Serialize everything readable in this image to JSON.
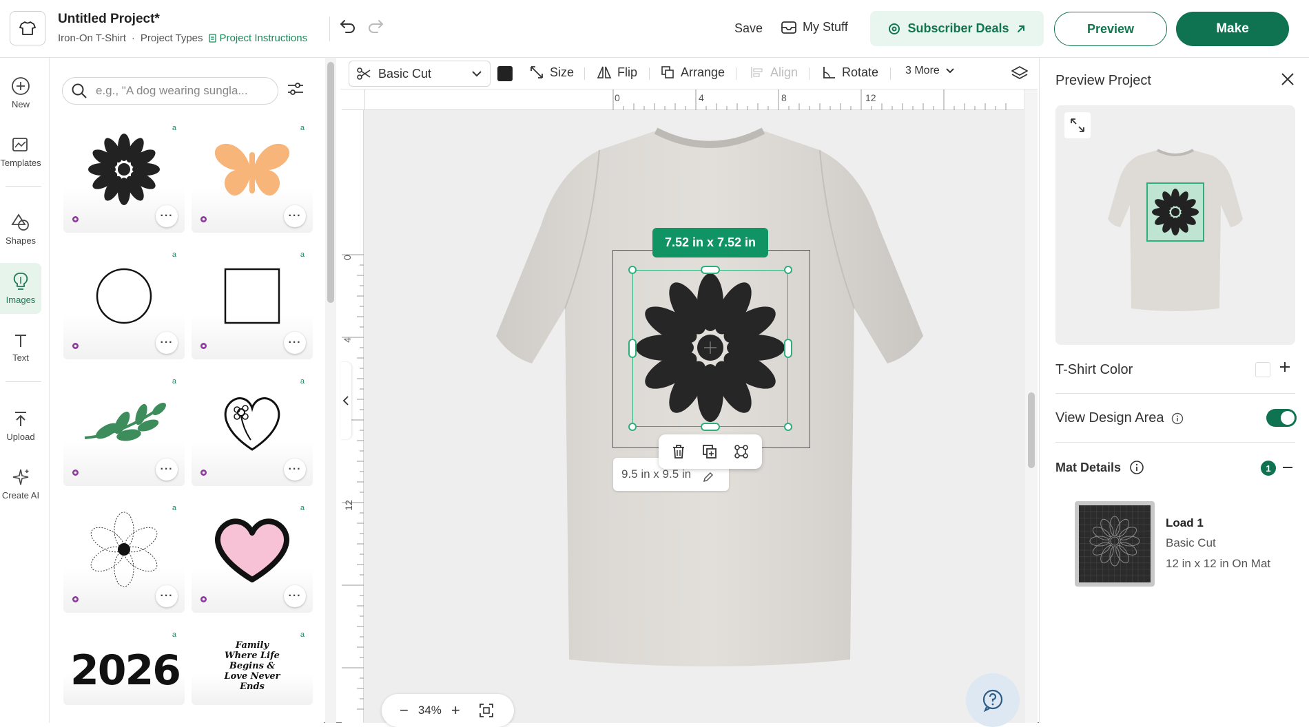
{
  "header": {
    "project_title": "Untitled Project*",
    "project_type": "Iron-On T-Shirt",
    "separator": "·",
    "project_types_link": "Project Types",
    "instructions_link": "Project Instructions",
    "save_label": "Save",
    "my_stuff_label": "My Stuff",
    "subscriber_deals_label": "Subscriber Deals",
    "preview_label": "Preview",
    "make_label": "Make"
  },
  "rail": {
    "items": [
      {
        "label": "New",
        "icon": "plus-circle-icon"
      },
      {
        "label": "Templates",
        "icon": "templates-icon"
      },
      {
        "label": "Shapes",
        "icon": "shapes-icon"
      },
      {
        "label": "Images",
        "icon": "lightbulb-icon",
        "active": true
      },
      {
        "label": "Text",
        "icon": "text-icon"
      },
      {
        "label": "Upload",
        "icon": "upload-icon"
      },
      {
        "label": "Create AI",
        "icon": "sparkle-icon"
      }
    ]
  },
  "images_panel": {
    "search_placeholder": "e.g., \"A dog wearing sungla...",
    "tiles": [
      {
        "name": "flower-black"
      },
      {
        "name": "butterfly-orange"
      },
      {
        "name": "circle-outline"
      },
      {
        "name": "square-outline"
      },
      {
        "name": "leaf-branch"
      },
      {
        "name": "heart-flower-line"
      },
      {
        "name": "flower-dotted"
      },
      {
        "name": "heart-pink"
      },
      {
        "name": "2026-graduation",
        "text": "2026"
      },
      {
        "name": "family-quote",
        "text": "Family Where Life Begins & Love Never Ends"
      }
    ],
    "more_label": "···"
  },
  "toolbar": {
    "operation": "Basic Cut",
    "size_label": "Size",
    "flip_label": "Flip",
    "arrange_label": "Arrange",
    "align_label": "Align",
    "rotate_label": "Rotate",
    "more_label": "3 More",
    "swatch_color": "#222222"
  },
  "canvas": {
    "ruler_top": [
      "0",
      "4",
      "8",
      "12"
    ],
    "ruler_left": [
      "0",
      "4",
      "8",
      "12"
    ],
    "selection_size": "7.52  in x 7.52  in",
    "design_area": "9.5 in x 9.5 in",
    "zoom": "34%"
  },
  "right_panel": {
    "title": "Preview Project",
    "tshirt_color_label": "T-Shirt Color",
    "view_design_area_label": "View Design Area",
    "mat_details_label": "Mat Details",
    "mat_count": "1",
    "load_title": "Load 1",
    "load_operation": "Basic Cut",
    "load_mat": "12 in x 12 in On Mat"
  },
  "colors": {
    "brand_green": "#0f7250",
    "accent_green": "#119463",
    "deals_bg": "#e8f6ef"
  }
}
